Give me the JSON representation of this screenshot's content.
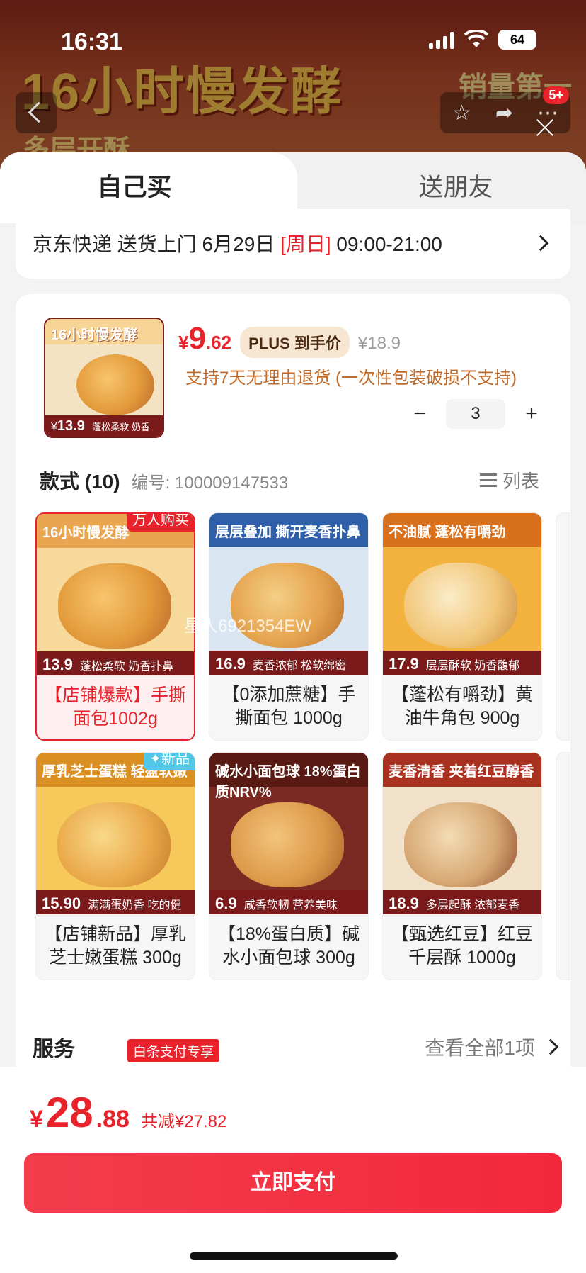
{
  "background": {
    "banner_text": "16小时慢发酵",
    "banner_sub": "多层开酥",
    "banner_right": "销量第一"
  },
  "status_bar": {
    "time": "16:31",
    "battery": "64"
  },
  "nav": {
    "cart_badge": "5+"
  },
  "tabs": {
    "self": "自己买",
    "friend": "送朋友"
  },
  "delivery": {
    "prefix": "京东快递 送货上门 6月29日 ",
    "day": "[周日]",
    "time": " 09:00-21:00"
  },
  "product": {
    "thumb_top": "16小时慢发酵",
    "thumb_price": "13.9",
    "thumb_desc": "蓬松柔软 奶香扑鼻",
    "price_currency": "¥",
    "price_int": "9",
    "price_dec": ".62",
    "plus_label": "PLUS 到手价",
    "original_price": "¥18.9",
    "return_note": "支持7天无理由退货 (一次性包装破损不支持)",
    "quantity": "3",
    "minus": "−",
    "plus": "+"
  },
  "styles": {
    "title": "款式 (10)",
    "code": "编号: 100009147533",
    "list_toggle": "列表",
    "items": [
      {
        "band_top": "16小时慢发酵",
        "price": "13.9",
        "desc": "蓬松柔软 奶香扑鼻",
        "name": "【店铺爆款】手撕面包1002g",
        "tag": "万人购买",
        "tag_color": "#e8232b",
        "selected": true,
        "bg": "#f6d99b",
        "food": "#e9a247"
      },
      {
        "band_top": "层层叠加 撕开麦香扑鼻",
        "price": "16.9",
        "desc": "麦香浓郁 松软绵密",
        "name": "【0添加蔗糖】手撕面包 1000g",
        "tag": "",
        "selected": false,
        "bg": "#d9e6f2",
        "food": "#eab266"
      },
      {
        "band_top": "不油腻 蓬松有嚼劲",
        "price": "17.9",
        "desc": "层层酥软 奶香馥郁",
        "name": "【蓬松有嚼劲】黄油牛角包 900g",
        "tag": "",
        "selected": false,
        "bg": "#f3b23d",
        "food": "#f6e0b0"
      },
      {
        "band_top": "厚乳芝士蛋糕 轻盈软嫩",
        "price": "15.90",
        "desc": "满满蛋奶香 吃的健康",
        "name": "【店铺新品】厚乳芝士嫩蛋糕 300g",
        "tag": "新品",
        "tag_color": "#52c8e8",
        "selected": false,
        "bg": "#f6c95a",
        "food": "#eaa94a"
      },
      {
        "band_top": "碱水小面包球 18%蛋白质NRV%",
        "price": "6.9",
        "desc": "咸香软韧 营养美味",
        "name": "【18%蛋白质】碱水小面包球 300g",
        "tag": "",
        "selected": false,
        "bg": "#7a2a22",
        "food": "#dd9a4a"
      },
      {
        "band_top": "麦香清香 夹着红豆醇香",
        "price": "18.9",
        "desc": "多层起酥 浓郁麦香",
        "name": "【甄选红豆】红豆千层酥 1000g",
        "tag": "",
        "selected": false,
        "bg": "#f1e1c9",
        "food": "#e8c394"
      }
    ],
    "watermark": "星人6921354EW"
  },
  "service": {
    "title": "服务",
    "more": "查看全部1项",
    "baitiao": "白条支付专享"
  },
  "footer": {
    "currency": "¥",
    "total_int": "28",
    "total_dec": ".88",
    "savings": "共减¥27.82",
    "pay_label": "立即支付"
  },
  "colors": {
    "accent": "#e8232b",
    "pay_button": "#f2283a"
  }
}
